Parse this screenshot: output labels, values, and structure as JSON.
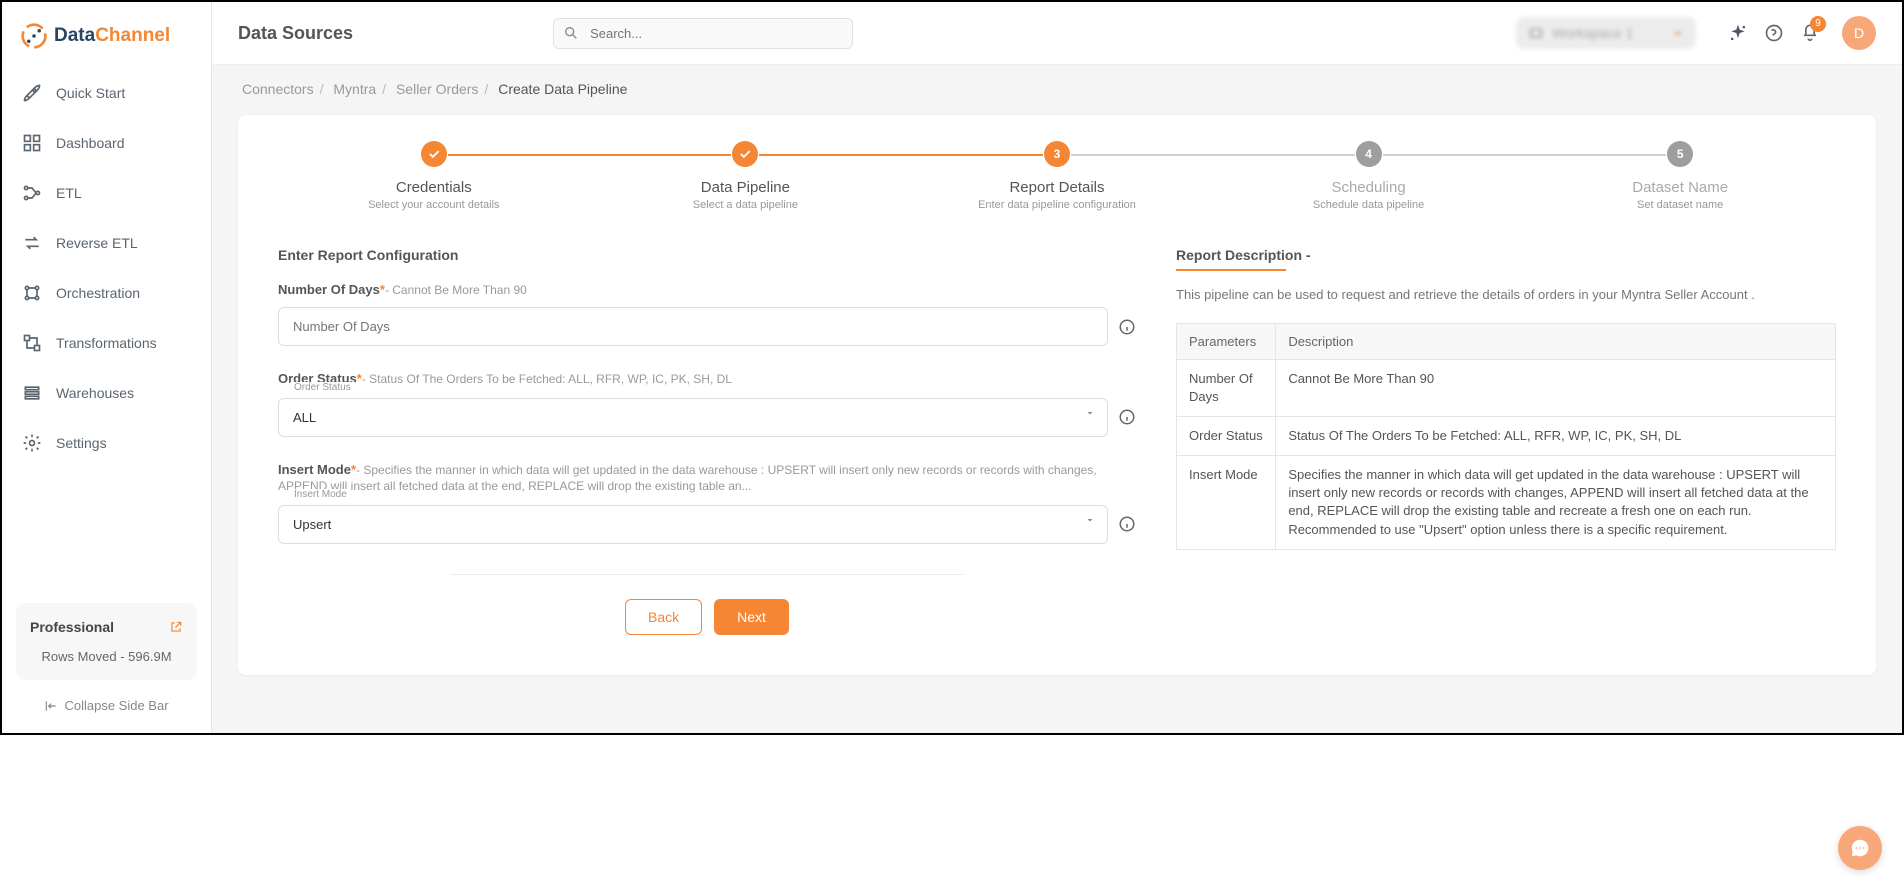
{
  "brand": {
    "name1": "Data",
    "name2": "Channel"
  },
  "nav": [
    {
      "label": "Quick Start"
    },
    {
      "label": "Dashboard"
    },
    {
      "label": "ETL"
    },
    {
      "label": "Reverse ETL"
    },
    {
      "label": "Orchestration"
    },
    {
      "label": "Transformations"
    },
    {
      "label": "Warehouses"
    },
    {
      "label": "Settings"
    }
  ],
  "plan": {
    "name": "Professional",
    "rows": "Rows Moved - 596.9M"
  },
  "collapse_label": "Collapse Side Bar",
  "header": {
    "title": "Data Sources",
    "search_placeholder": "Search...",
    "workspace": "Workspace 1",
    "badge": "9",
    "avatar": "D"
  },
  "breadcrumb": [
    "Connectors",
    "Myntra",
    "Seller Orders",
    "Create Data Pipeline"
  ],
  "steps": [
    {
      "title": "Credentials",
      "sub": "Select your account details",
      "state": "done"
    },
    {
      "title": "Data Pipeline",
      "sub": "Select a data pipeline",
      "state": "done"
    },
    {
      "title": "Report Details",
      "sub": "Enter data pipeline configuration",
      "state": "active",
      "num": "3"
    },
    {
      "title": "Scheduling",
      "sub": "Schedule data pipeline",
      "state": "pending",
      "num": "4"
    },
    {
      "title": "Dataset Name",
      "sub": "Set dataset name",
      "state": "pending",
      "num": "5"
    }
  ],
  "form": {
    "section_title": "Enter Report Configuration",
    "days": {
      "label": "Number Of Days",
      "hint": "- Cannot Be More Than 90",
      "placeholder": "Number Of Days"
    },
    "status": {
      "label": "Order Status",
      "hint": "- Status Of The Orders To be Fetched: ALL, RFR, WP, IC, PK, SH, DL",
      "floating": "Order Status",
      "value": "ALL"
    },
    "mode": {
      "label": "Insert Mode",
      "hint": "- Specifies the manner in which data will get updated in the data warehouse : UPSERT will insert only new records or records with changes, APPEND will insert all fetched data at the end, REPLACE will drop the existing table an...",
      "floating": "Insert Mode",
      "value": "Upsert"
    }
  },
  "desc": {
    "title": "Report Description -",
    "text": "This pipeline can be used to request and retrieve the details of orders in your Myntra Seller Account .",
    "headers": [
      "Parameters",
      "Description"
    ],
    "rows": [
      {
        "p": "Number Of Days",
        "d": "Cannot Be More Than 90"
      },
      {
        "p": "Order Status",
        "d": "Status Of The Orders To be Fetched: ALL, RFR, WP, IC, PK, SH, DL"
      },
      {
        "p": "Insert Mode",
        "d": "Specifies the manner in which data will get updated in the data warehouse : UPSERT will insert only new records or records with changes, APPEND will insert all fetched data at the end, REPLACE will drop the existing table and recreate a fresh one on each run. Recommended to use \"Upsert\" option unless there is a specific requirement."
      }
    ]
  },
  "buttons": {
    "back": "Back",
    "next": "Next"
  }
}
